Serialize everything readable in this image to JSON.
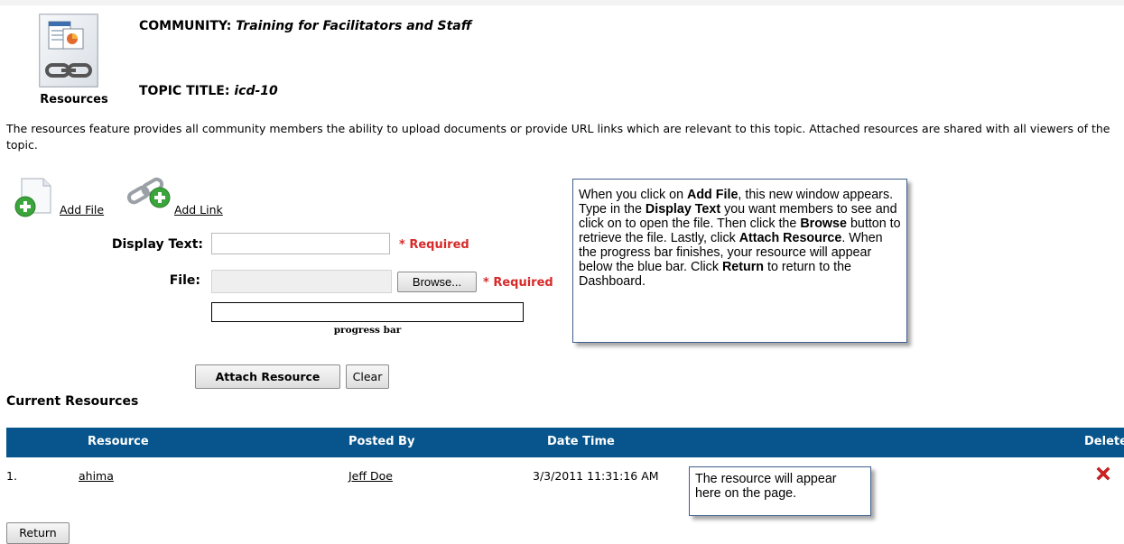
{
  "header": {
    "resources_label": "Resources",
    "community_prefix": "COMMUNITY:",
    "community_name": "Training for Facilitators and Staff",
    "topic_prefix": "TOPIC TITLE:",
    "topic_name": "icd-10"
  },
  "intro": "The resources feature provides all community members the ability to upload documents or provide URL links which are relevant to this topic. Attached resources are shared with all viewers of the topic.",
  "actions": {
    "add_file": "Add File",
    "add_link": "Add Link"
  },
  "form": {
    "display_text_label": "Display Text:",
    "display_text_value": "",
    "file_label": "File:",
    "file_value": "",
    "browse_label": "Browse...",
    "required_label": "* Required",
    "progress_label": "progress bar",
    "progress_fraction": 0,
    "attach_label": "Attach Resource",
    "clear_label": "Clear"
  },
  "callouts": {
    "add_file": {
      "p1": "When you click on ",
      "b1": "Add File",
      "p2": ", this new window appears. Type in the ",
      "b2": "Display Text",
      "p3": " you want members to see and click on to open the file. Then click the ",
      "b3": "Browse",
      "p4": " button to retrieve the file. Lastly, click ",
      "b4": "Attach Resource",
      "p5": ". When the progress bar finishes, your resource will appear below the blue bar. Click ",
      "b5": "Return",
      "p6": " to return to the Dashboard."
    },
    "resource": "The resource will appear here on the page."
  },
  "current_resources": {
    "title": "Current Resources",
    "columns": {
      "resource": "Resource",
      "posted_by": "Posted By",
      "date_time": "Date Time",
      "delete": "Delete"
    },
    "rows": [
      {
        "index": "1.",
        "resource": "ahima",
        "posted_by": "Jeff Doe",
        "date_time": "3/3/2011 11:31:16 AM"
      }
    ]
  },
  "return_label": "Return",
  "colors": {
    "table_header": "#07558c",
    "required": "#d62a2a",
    "add_green": "#3aa53a",
    "delete_red": "#d61f1f"
  },
  "icons": {
    "resources": "resources-chain-icon",
    "add_file": "add-file-icon",
    "add_link": "add-link-icon",
    "delete": "delete-x-icon"
  }
}
